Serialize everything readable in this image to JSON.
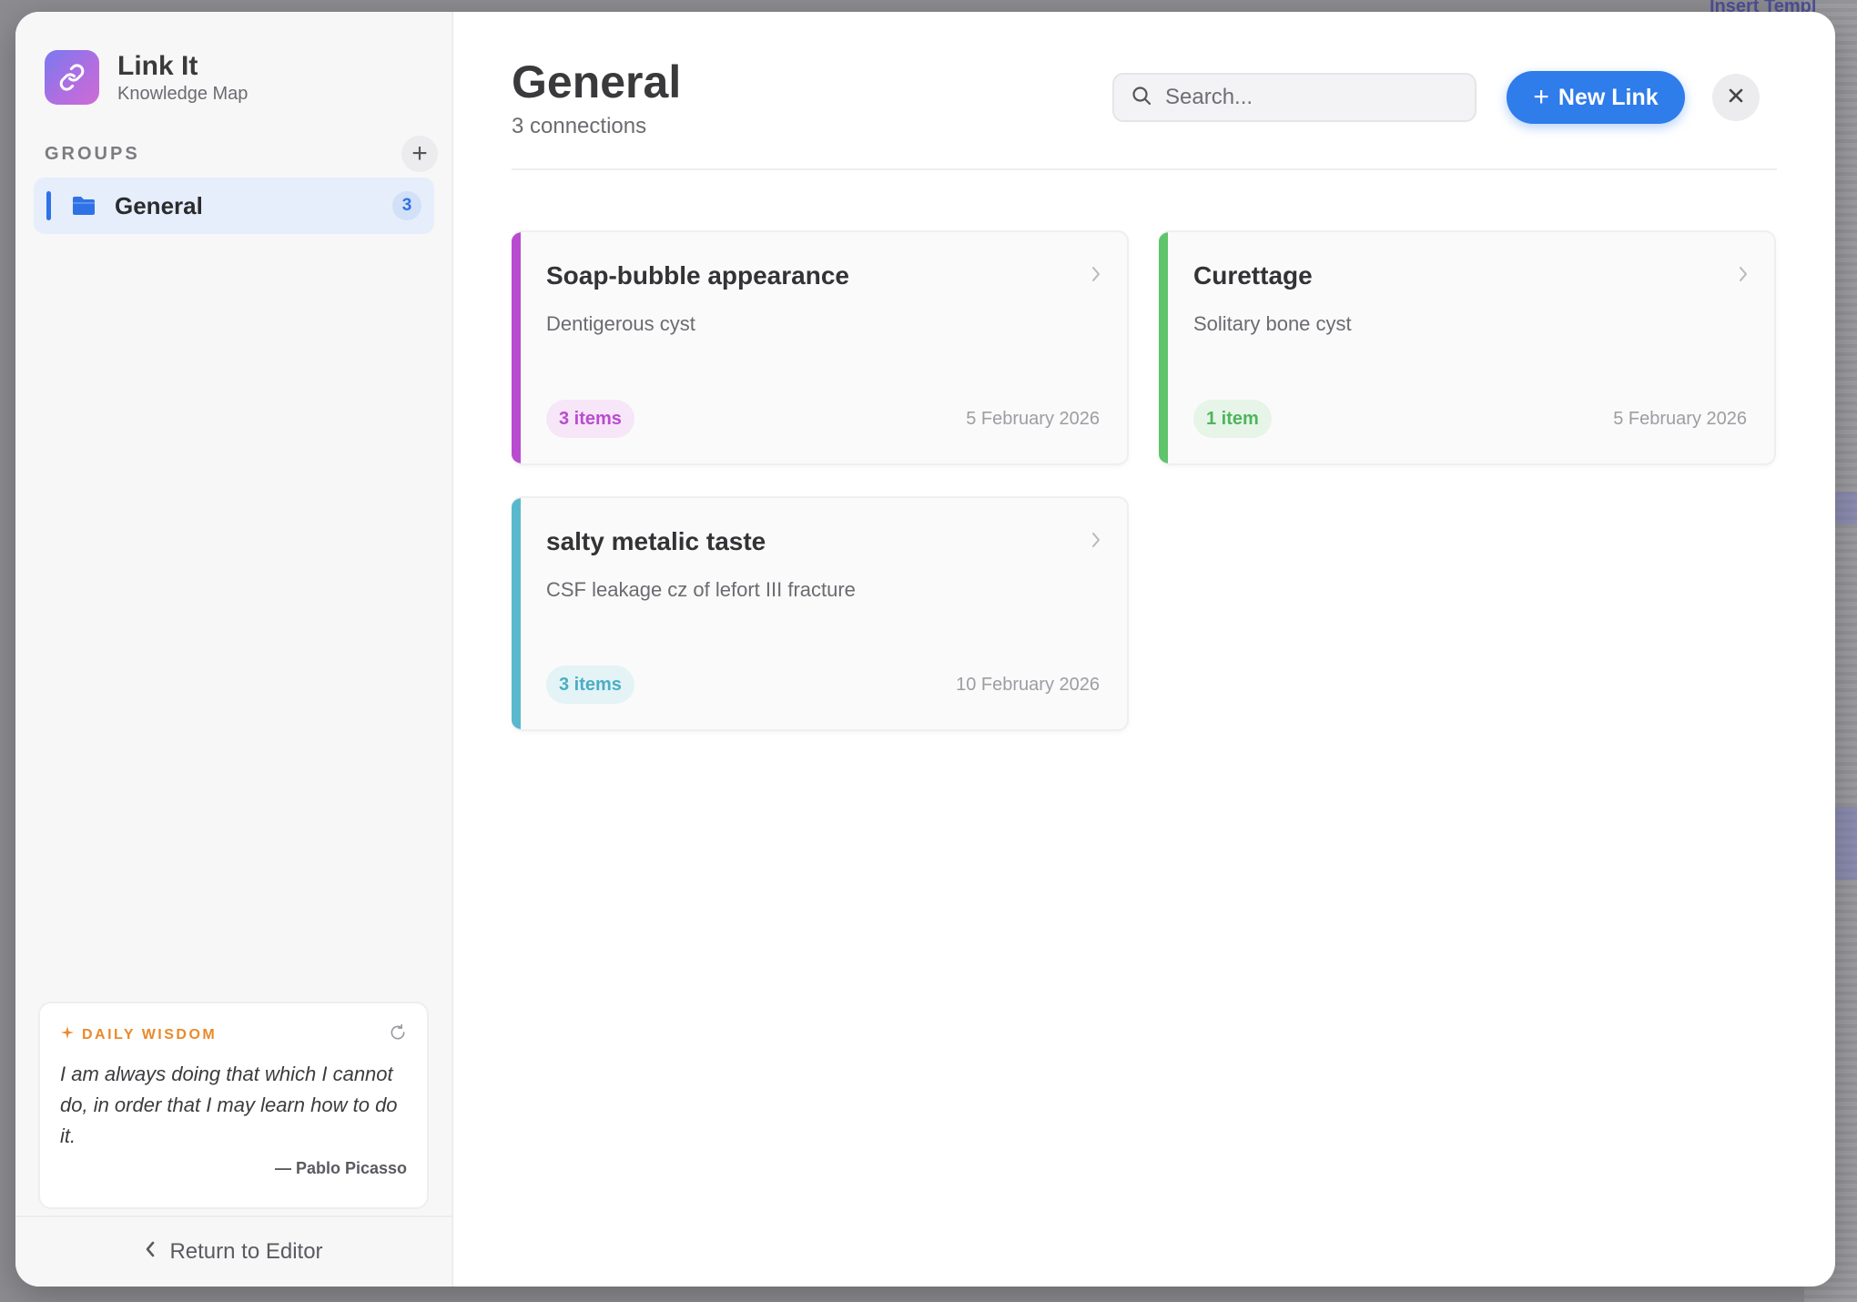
{
  "backdrop": {
    "insert_template_label": "Insert Templ"
  },
  "sidebar": {
    "brand_title": "Link It",
    "brand_subtitle": "Knowledge Map",
    "groups_label": "GROUPS",
    "add_group_symbol": "+",
    "groups": [
      {
        "name": "General",
        "count": "3"
      }
    ],
    "wisdom": {
      "label": "DAILY WISDOM",
      "quote": "I am always doing that which I cannot do, in order that I may learn how to do it.",
      "author": "— Pablo Picasso"
    },
    "return_label": "Return to Editor"
  },
  "header": {
    "title": "General",
    "subtitle": "3 connections",
    "search_placeholder": "Search...",
    "new_link_label": "New Link",
    "new_link_symbol": "+"
  },
  "cards": [
    {
      "title": "Soap-bubble appearance",
      "subtitle": "Dentigerous cyst",
      "badge": "3 items",
      "date": "5 February 2026",
      "accent": "#b94bd0",
      "badge_bg": "#f6e6f8",
      "badge_fg": "#b94bd0"
    },
    {
      "title": "Curettage",
      "subtitle": "Solitary bone cyst",
      "badge": "1 item",
      "date": "5 February 2026",
      "accent": "#5fc46a",
      "badge_bg": "#e6f5e8",
      "badge_fg": "#4fb45c"
    },
    {
      "title": "salty metalic taste",
      "subtitle": "CSF leakage cz of lefort III fracture",
      "badge": "3 items",
      "date": "10 February 2026",
      "accent": "#5ab8cc",
      "badge_bg": "#e3f3f6",
      "badge_fg": "#4aaec4"
    }
  ],
  "colors": {
    "primary": "#2f7ceb",
    "wisdom_accent": "#e98a2a"
  }
}
